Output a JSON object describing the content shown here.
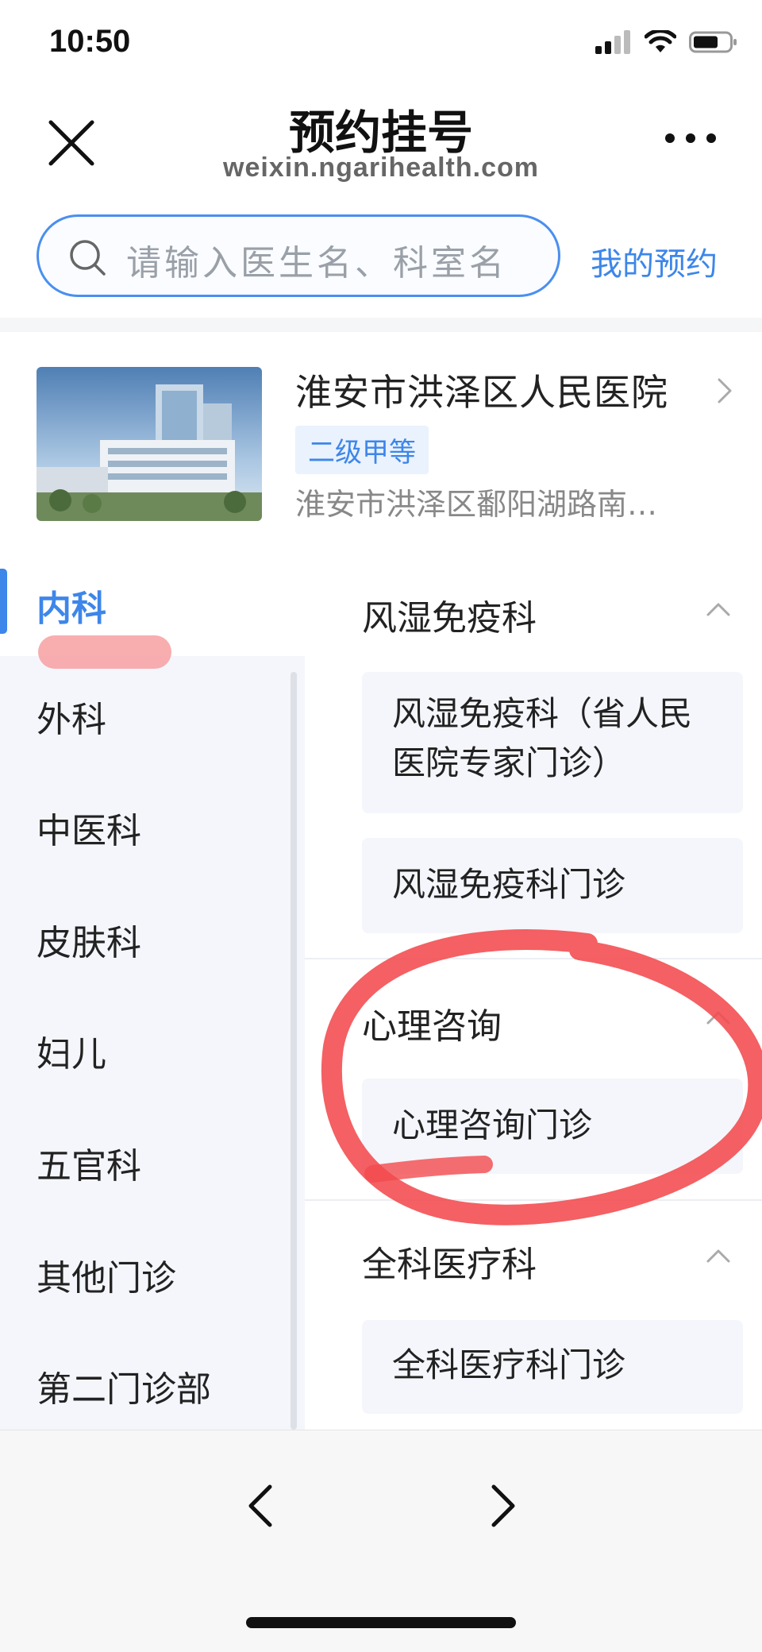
{
  "status_bar": {
    "time": "10:50"
  },
  "nav": {
    "title": "预约挂号",
    "url": "weixin.ngarihealth.com"
  },
  "search": {
    "placeholder": "请输入医生名、科室名",
    "my_appointments": "我的预约"
  },
  "hospital": {
    "name": "淮安市洪泽区人民医院",
    "grade": "二级甲等",
    "address": "淮安市洪泽区鄱阳湖路南…"
  },
  "categories": [
    {
      "label": "内科",
      "active": true
    },
    {
      "label": "外科"
    },
    {
      "label": "中医科"
    },
    {
      "label": "皮肤科"
    },
    {
      "label": "妇儿"
    },
    {
      "label": "五官科"
    },
    {
      "label": "其他门诊"
    },
    {
      "label": "第二门诊部"
    }
  ],
  "departments": [
    {
      "title": "风湿免疫科",
      "items": [
        "风湿免疫科（省人民医院专家门诊）",
        "风湿免疫科门诊"
      ]
    },
    {
      "title": "心理咨询",
      "items": [
        "心理咨询门诊"
      ]
    },
    {
      "title": "全科医疗科",
      "items": [
        "全科医疗科门诊"
      ]
    }
  ],
  "colors": {
    "accent": "#3d86ea",
    "annotation": "#f24a4d",
    "left_panel_bg": "#f4f6fb"
  }
}
